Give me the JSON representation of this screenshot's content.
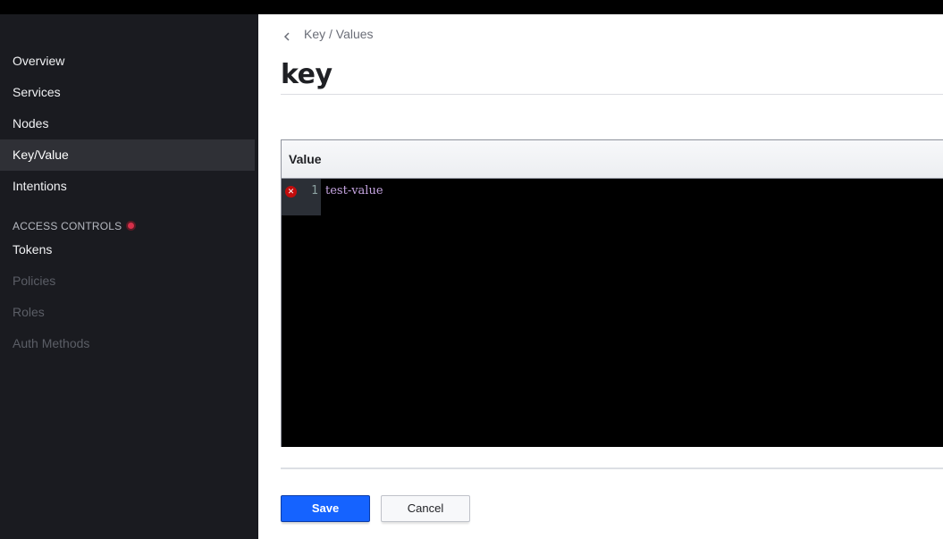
{
  "sidebar": {
    "items": [
      {
        "label": "Overview"
      },
      {
        "label": "Services"
      },
      {
        "label": "Nodes"
      },
      {
        "label": "Key/Value",
        "active": true
      },
      {
        "label": "Intentions"
      }
    ],
    "section": {
      "title": "ACCESS CONTROLS",
      "badge_color": "#d6304a",
      "items": [
        {
          "label": "Tokens"
        },
        {
          "label": "Policies",
          "disabled": true
        },
        {
          "label": "Roles",
          "disabled": true
        },
        {
          "label": "Auth Methods",
          "disabled": true
        }
      ]
    }
  },
  "breadcrumb": {
    "back_icon": "chevron-left-icon",
    "label": "Key / Values"
  },
  "page": {
    "title": "key"
  },
  "editor": {
    "header_label": "Value",
    "lines": [
      {
        "number": "1",
        "text": "test-value",
        "error": true,
        "error_icon": "error-x-icon"
      }
    ]
  },
  "actions": {
    "save_label": "Save",
    "cancel_label": "Cancel",
    "save_color": "#1563ff"
  }
}
